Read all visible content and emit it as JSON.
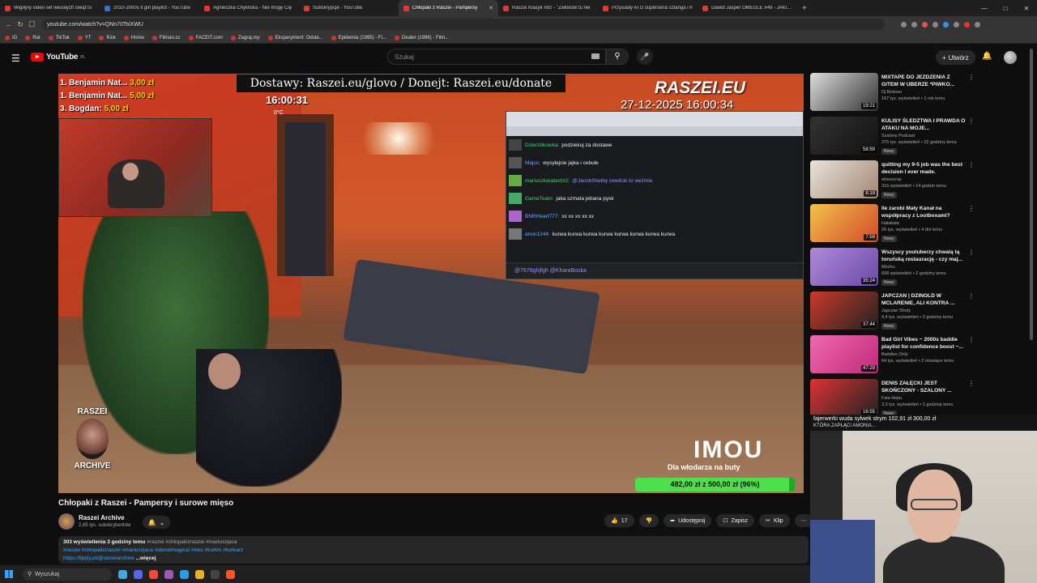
{
  "browser": {
    "tabs": [
      {
        "title": "Wigilijny video set wesołych świąt to",
        "active": false
      },
      {
        "title": "2010-2000s it girl playlist - YouTube",
        "active": false
      },
      {
        "title": "Agnieszka Chylińska - Nie mogę Cię",
        "active": false
      },
      {
        "title": "Subskrypcje - YouTube",
        "active": false
      },
      {
        "title": "Chłopaki z Raszei - Pampersy",
        "active": true
      },
      {
        "title": "Raszei Klasyk #92 - \"Zwłoków tu nie",
        "active": false
      },
      {
        "title": "Przysiady ATG superseria sztanga i h",
        "active": false
      },
      {
        "title": "Dawid Jasper OMEGLE #49 - JAKIE M",
        "active": false
      }
    ],
    "url": "youtube.com/watch?v=QNn70TsiXWU",
    "bookmarks": [
      "IG",
      "Rat",
      "TikTok",
      "YT",
      "Kick",
      "Home",
      "Filman.cc",
      "FACEIT.com",
      "Zagraj.my",
      "Eksperyment: Odsła...",
      "Epidemia (1995) - Fi...",
      "Dealer (1996) - Film..."
    ]
  },
  "header": {
    "logo": "YouTube",
    "region": "PL",
    "search_placeholder": "Szukaj",
    "create_label": "Utwórz"
  },
  "player": {
    "donors": [
      {
        "rank": "1.",
        "name": "Benjamin Nat...",
        "amount": "3,00 zł"
      },
      {
        "rank": "1.",
        "name": "Benjamin Nat...",
        "amount": "5,00 zł"
      },
      {
        "rank": "3.",
        "name": "Bogdan:",
        "amount": "5,00 zł"
      }
    ],
    "banner": "Dostawy: Raszei.eu/glovo / Donejt: Raszei.eu/donate",
    "clock": "16:00:31",
    "temp": "0°C",
    "brand": "RASZEI.EU",
    "datestamp": "27-12-2025 16:00:34",
    "chat": [
      {
        "user": "Dzierzbkowka:",
        "message": "podziekuj za dostawe",
        "color": "green"
      },
      {
        "user": "Majus:",
        "message": "wysyłajcie jajka i cebule",
        "color": "white"
      },
      {
        "user": "mariuszkaratecbr2:",
        "message": "@JacobShelby cwelicki to weźmie",
        "color": "mention"
      },
      {
        "user": "GameTeam:",
        "message": "jaka szmata jebana pysk",
        "color": "green"
      },
      {
        "user": "BNRHeart777:",
        "message": "xx xx xx xx xx",
        "color": "white"
      },
      {
        "user": "anon1244:",
        "message": "kurwa kurwa kurwa kurwa kurwa kurwa kurwa kurwa",
        "color": "white"
      }
    ],
    "chat_input": "@7678ghjfgh @KharaBoska",
    "archive_top": "RASZEI",
    "archive_bottom": "ARCHIVE",
    "imou": "IMOU",
    "imou_sub": "Dla włodarza na buty",
    "goal_text": "482,00 zł z 500,00 zł",
    "goal_percent": "(96%)",
    "goal_fraction": 0.964
  },
  "video": {
    "title": "Chłopaki z Raszei - Pampersy i surowe mięso",
    "channel": "Raszei Archive",
    "subscribers": "2,65 tys. subskrybentów",
    "likes": "17",
    "share_label": "Udostępnij",
    "save_label": "Zapisz",
    "clip_label": "Klip",
    "description": {
      "views": "303 wyświetlenia  3 godziny temu",
      "line1_tags": "#raszei #chlopakizraszei #mariuszjaca",
      "line2_tags": "#raszei #chlopakizraszei #mariuszjaca #danielmagical #kws #korkin #korkarz",
      "link": "https://tipply.pl/@raszeiarchive",
      "more": "...więcej"
    }
  },
  "recommendations": [
    {
      "title": "MIXTAPE DO JEZDZENIA Z GITEM W UBERZE *PIWKO...",
      "channel": "Dj Betewu",
      "meta": "167 tys. wyświetleń • 1 rok temu",
      "duration": "19:21",
      "new": false,
      "colors": [
        "#ddd",
        "#333"
      ]
    },
    {
      "title": "KULISY ŚLEDZTWA I PRAWDA O ATAKU NA MOJE...",
      "channel": "Szalony Podcast",
      "meta": "375 tys. wyświetleń • 22 godziny temu",
      "duration": "58:59",
      "new": true,
      "colors": [
        "#333",
        "#111"
      ]
    },
    {
      "title": "quitting my 9-5 job was the best decision I ever made.",
      "channel": "eliseocray",
      "meta": "316 wyświetleń • 14 godzin temu",
      "duration": "8:19",
      "new": true,
      "colors": [
        "#e9e4dc",
        "#a28670"
      ]
    },
    {
      "title": "Ile zarobi Mały Kanał na współpracy z Lootboxami?",
      "channel": "Halabala",
      "meta": "26 tys. wyświetleń • 4 dni temu",
      "duration": "7:59",
      "new": true,
      "colors": [
        "#f3c24a",
        "#d24a2a"
      ]
    },
    {
      "title": "Wszyscy youtuberzy chwalą tą toruńską restaurację - czy maj...",
      "channel": "Mechu",
      "meta": "608 wyświetleń • 2 godziny temu",
      "duration": "35:24",
      "new": true,
      "colors": [
        "#b08ad8",
        "#6a4aa8"
      ]
    },
    {
      "title": "JAPCZAN | DZINOLD W MCLARENIE, ALI KONTRA ...",
      "channel": "Japczan Shoty",
      "meta": "4,4 tys. wyświetleń • 2 godziny temu",
      "duration": "37:44",
      "new": true,
      "colors": [
        "#c93a2a",
        "#222"
      ]
    },
    {
      "title": "Bad Girl Vibes ~ 2000s baddie playlist for confidence boost ~...",
      "channel": "Baddies Only",
      "meta": "64 tys. wyświetleń • 2 miesiące temu",
      "duration": "47:29",
      "new": false,
      "colors": [
        "#f06ab0",
        "#c02a7a"
      ]
    },
    {
      "title": "DENIS ZAŁĘCKI JEST SKOŃCZONY - SZALONY ...",
      "channel": "Fala Hejtu",
      "meta": "3,3 tys. wyświetleń • 1 godzinę temu",
      "duration": "16:55",
      "new": true,
      "colors": [
        "#d33",
        "#222"
      ]
    }
  ],
  "stream_alert": {
    "name": "fajerwerki wuda sylwek strym",
    "amount": "102,91 zł",
    "goal": "300,00 zł",
    "sub": "KTÓRA ZAPŁĄCI AMONIA..."
  },
  "taskbar": {
    "search_label": "Wyszukaj"
  }
}
